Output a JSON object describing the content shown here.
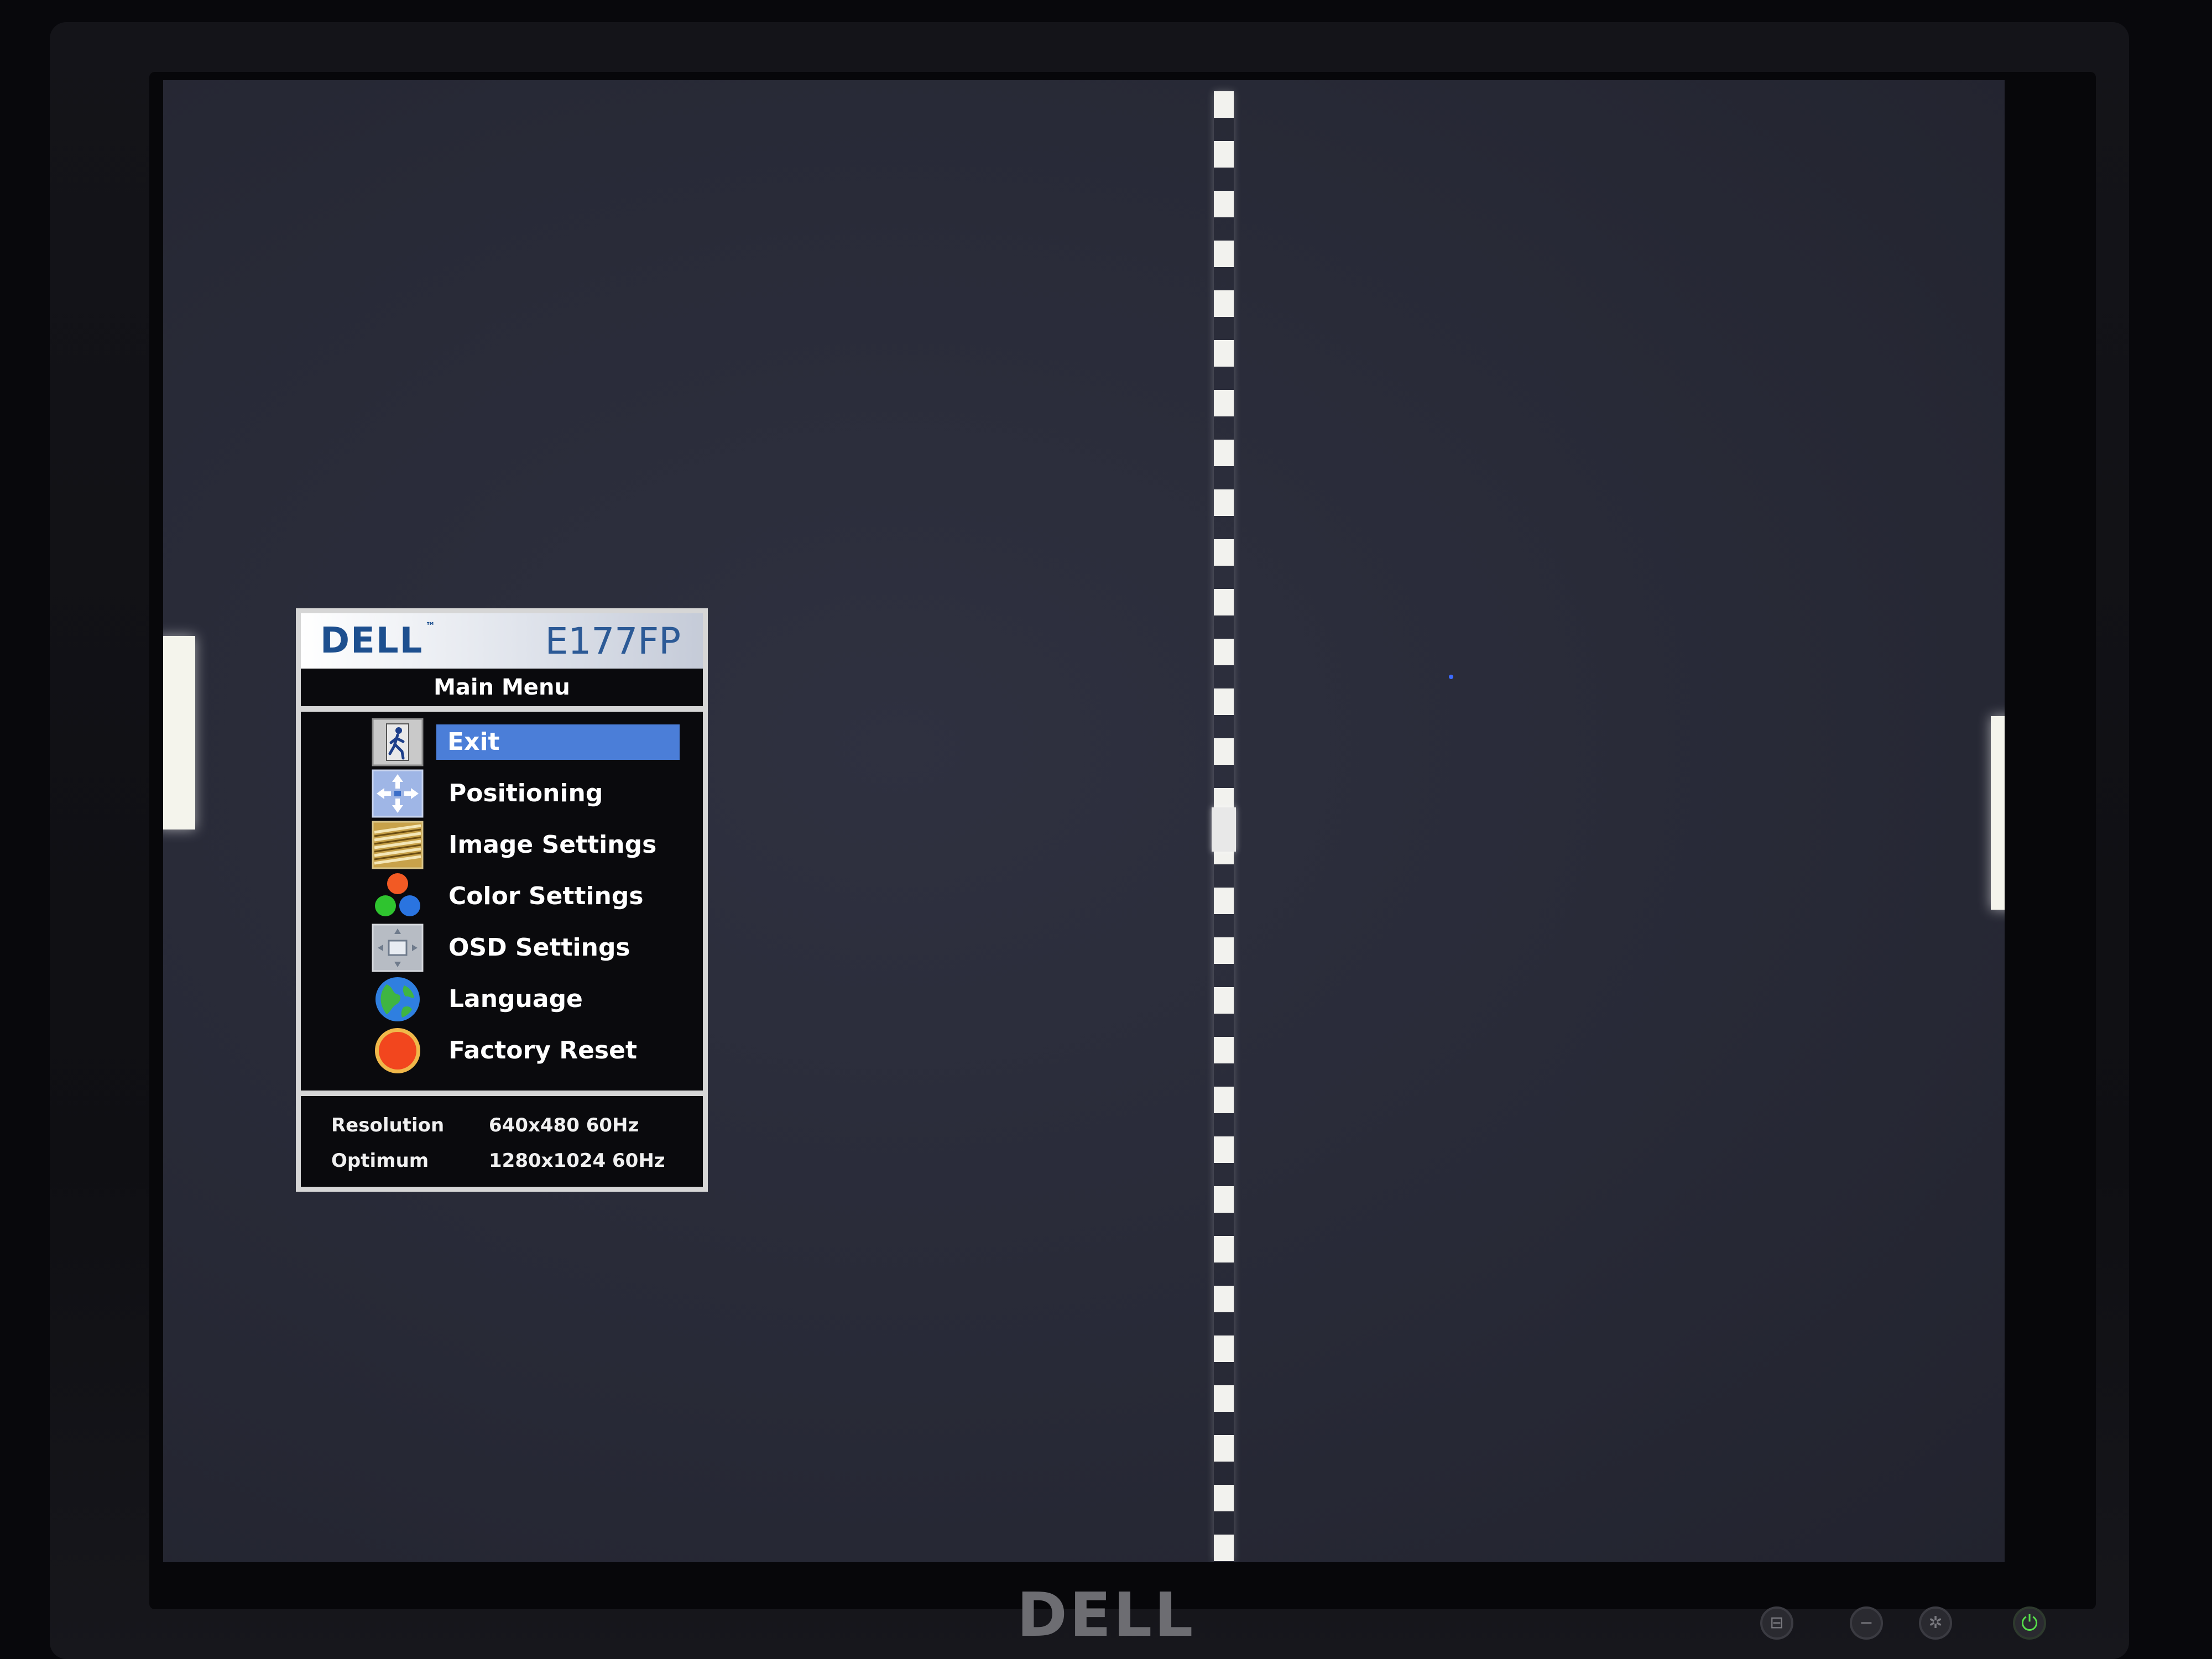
{
  "osd": {
    "brand": "DELL",
    "trademark": "™",
    "model": "E177FP",
    "title": "Main Menu",
    "items": [
      {
        "label": "Exit",
        "icon": "exit-icon",
        "selected": true
      },
      {
        "label": "Positioning",
        "icon": "positioning-icon",
        "selected": false
      },
      {
        "label": "Image Settings",
        "icon": "image-settings-icon",
        "selected": false
      },
      {
        "label": "Color Settings",
        "icon": "color-settings-icon",
        "selected": false
      },
      {
        "label": "OSD Settings",
        "icon": "osd-settings-icon",
        "selected": false
      },
      {
        "label": "Language",
        "icon": "globe-icon",
        "selected": false
      },
      {
        "label": "Factory Reset",
        "icon": "factory-reset-icon",
        "selected": false
      }
    ],
    "resolution_label": "Resolution",
    "resolution_value": "640x480 60Hz",
    "optimum_label": "Optimum",
    "optimum_value": "1280x1024 60Hz"
  },
  "bezel": {
    "logo": "DELL",
    "buttons": [
      {
        "name": "input-icon",
        "glyph": "⊟"
      },
      {
        "name": "minus-icon",
        "glyph": "−"
      },
      {
        "name": "menu-icon",
        "glyph": "✲"
      },
      {
        "name": "power-icon",
        "glyph": "⏻"
      }
    ]
  },
  "colors": {
    "selection": "#4b7ed8",
    "power_led": "#56e04a",
    "osd_border": "#d6d6d6"
  }
}
